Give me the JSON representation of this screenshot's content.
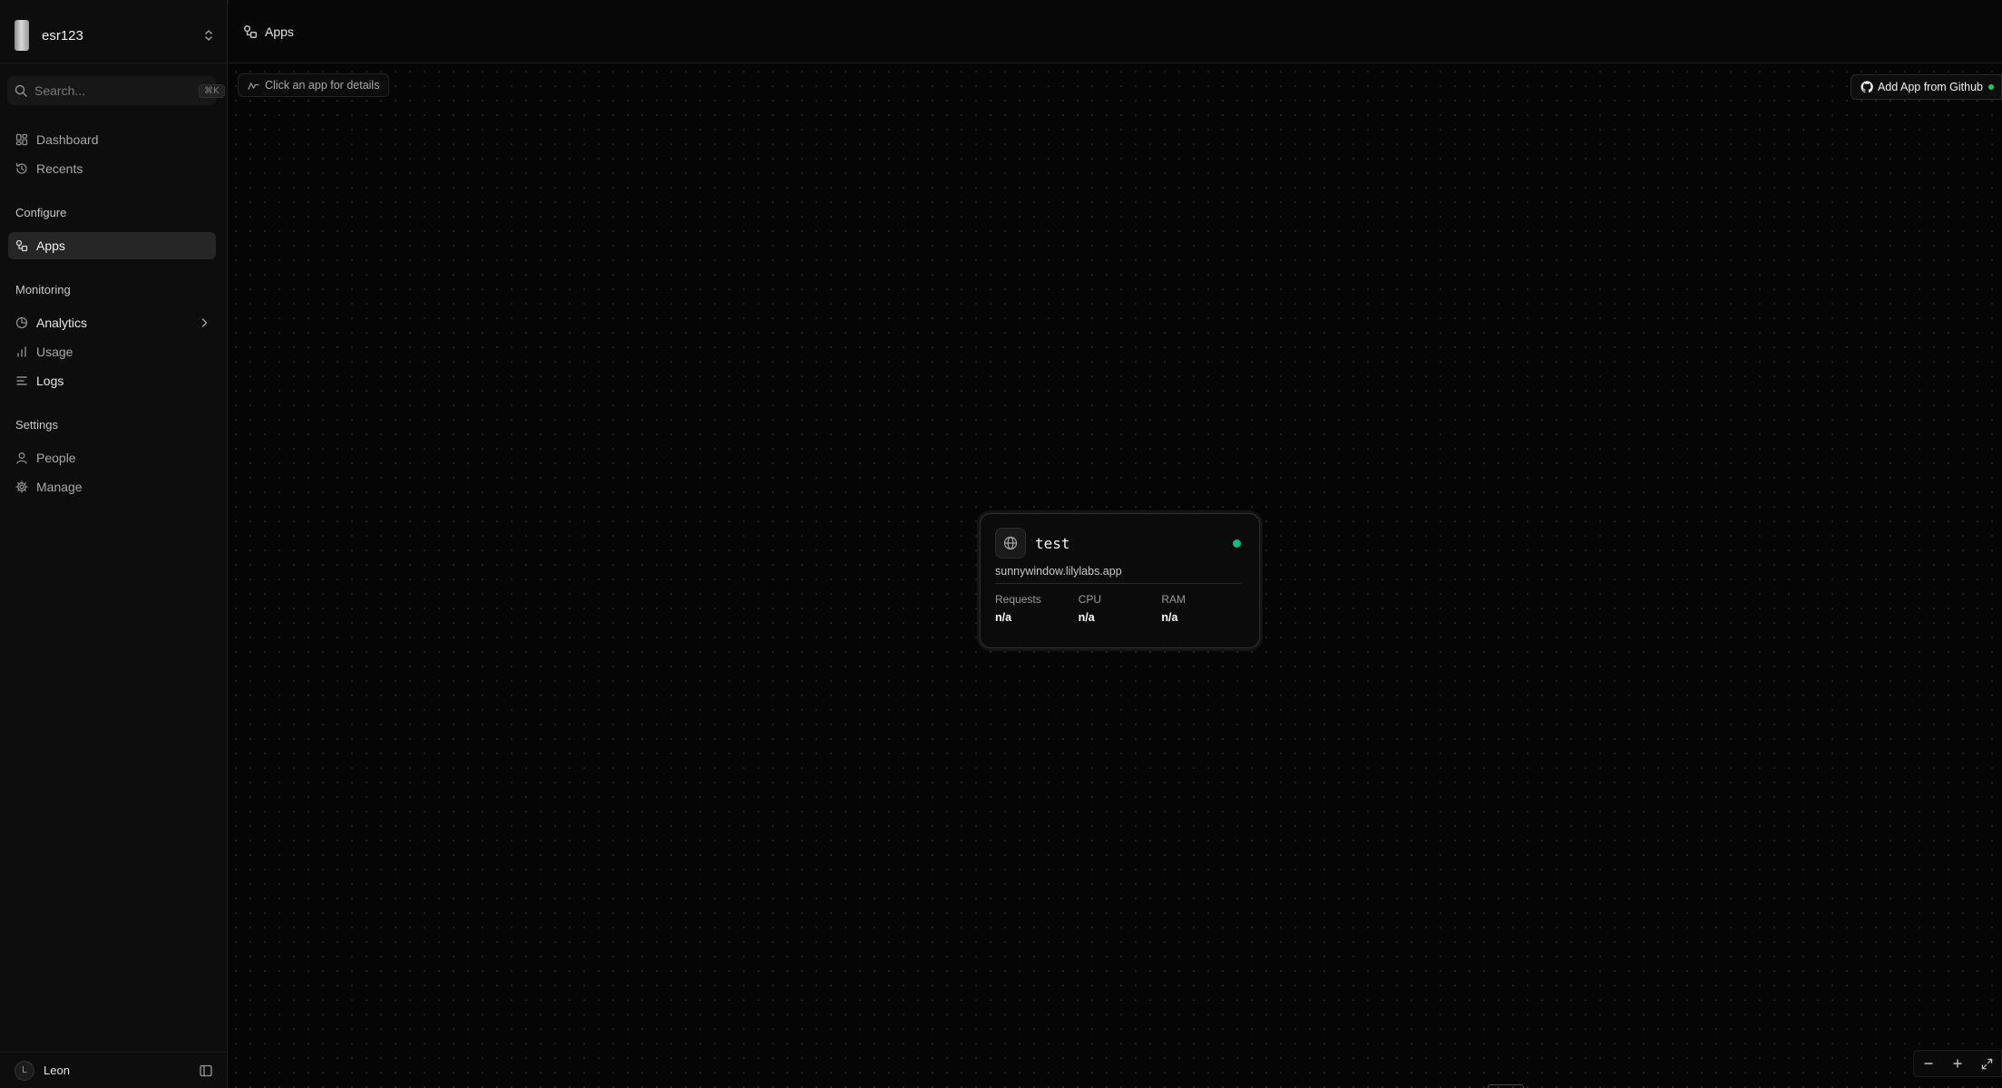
{
  "workspace": {
    "name": "esr123"
  },
  "search": {
    "placeholder": "Search...",
    "shortcut": "⌘K"
  },
  "sidebar": {
    "top_items": [
      {
        "label": "Dashboard",
        "icon": "dashboard-icon"
      },
      {
        "label": "Recents",
        "icon": "history-icon"
      }
    ],
    "sections": {
      "configure": {
        "label": "Configure",
        "items": [
          {
            "label": "Apps",
            "icon": "apps-icon",
            "active": true
          }
        ]
      },
      "monitoring": {
        "label": "Monitoring",
        "items": [
          {
            "label": "Analytics",
            "icon": "pie-chart-icon"
          },
          {
            "label": "Usage",
            "icon": "bar-chart-icon"
          },
          {
            "label": "Logs",
            "icon": "list-icon"
          }
        ]
      },
      "settings": {
        "label": "Settings",
        "items": [
          {
            "label": "People",
            "icon": "user-icon"
          },
          {
            "label": "Manage",
            "icon": "gear-icon"
          }
        ]
      }
    }
  },
  "user": {
    "name": "Leon",
    "initial": "L"
  },
  "header": {
    "title": "Apps"
  },
  "canvas": {
    "hint": "Click an app for details",
    "add_github_label": "Add App from Github"
  },
  "app_card": {
    "name": "test",
    "url": "sunnywindow.lilylabs.app",
    "status_color": "#10b981",
    "metrics": [
      {
        "label": "Requests",
        "value": "n/a"
      },
      {
        "label": "CPU",
        "value": "n/a"
      },
      {
        "label": "RAM",
        "value": "n/a"
      }
    ]
  }
}
